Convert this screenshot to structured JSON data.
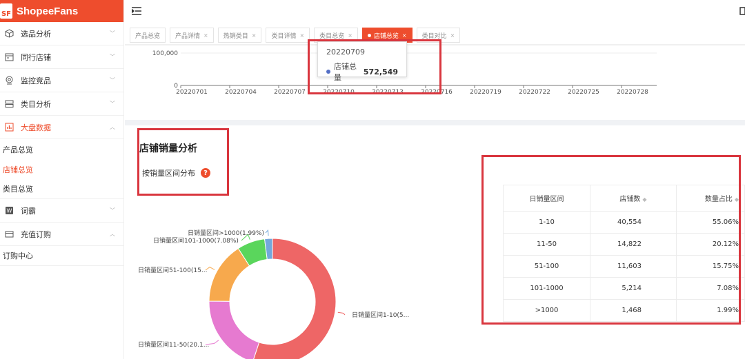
{
  "brand": {
    "logo": "SF",
    "name": "ShopeeFans"
  },
  "sidebar": {
    "items": [
      {
        "label": "选品分析",
        "icon": "cube-icon"
      },
      {
        "label": "同行店铺",
        "icon": "store-icon"
      },
      {
        "label": "监控竞品",
        "icon": "monitor-icon"
      },
      {
        "label": "类目分析",
        "icon": "category-icon"
      },
      {
        "label": "大盘数据",
        "icon": "chart-icon"
      }
    ],
    "dapan_sub": [
      "产品总览",
      "店铺总览",
      "类目总览"
    ],
    "items2": [
      {
        "label": "词霸",
        "icon": "word-icon"
      },
      {
        "label": "充值订购",
        "icon": "wallet-icon"
      }
    ],
    "recharge_sub": [
      "订购中心"
    ]
  },
  "tabs": [
    "产品总览",
    "产品详情",
    "热销类目",
    "类目详情",
    "类目总览",
    "店铺总览",
    "类目对比"
  ],
  "top_chart": {
    "chart_data": {
      "type": "line",
      "y_ticks": [
        "100,000",
        "0"
      ],
      "x": [
        "20220701",
        "20220704",
        "20220707",
        "20220710",
        "20220713",
        "20220716",
        "20220719",
        "20220722",
        "20220725",
        "20220728"
      ]
    },
    "tooltip": {
      "date": "20220709",
      "name": "店铺总量",
      "value": "572,549"
    }
  },
  "section": {
    "title": "店铺销量分析",
    "subtitle": "按销量区间分布",
    "help": "?"
  },
  "donut": {
    "chart_data": {
      "type": "pie",
      "slices": [
        {
          "name": "日销量区间1-10",
          "value": 55.06,
          "color": "#ee6666",
          "label": "日销量区间1-10(5..."
        },
        {
          "name": "日销量区间11-50",
          "value": 20.12,
          "color": "#e67ad0",
          "label": "日销量区间11-50(20.1..."
        },
        {
          "name": "日销量区间51-100",
          "value": 15.75,
          "color": "#f7a94d",
          "label": "日销量区间51-100(15..."
        },
        {
          "name": "日销量区间101-1000",
          "value": 7.08,
          "color": "#5ad65c",
          "label": "日销量区间101-1000(7.08%)"
        },
        {
          "name": "日销量区间>1000",
          "value": 1.99,
          "color": "#73a8dc",
          "label": "日销量区间>1000(1.99%)"
        }
      ]
    }
  },
  "table": {
    "headers": [
      "日销量区间",
      "店铺数",
      "数量占比"
    ],
    "rows": [
      [
        "1-10",
        "40,554",
        "55.06%"
      ],
      [
        "11-50",
        "14,822",
        "20.12%"
      ],
      [
        "51-100",
        "11,603",
        "15.75%"
      ],
      [
        "101-1000",
        "5,214",
        "7.08%"
      ],
      [
        ">1000",
        "1,468",
        "1.99%"
      ]
    ]
  }
}
